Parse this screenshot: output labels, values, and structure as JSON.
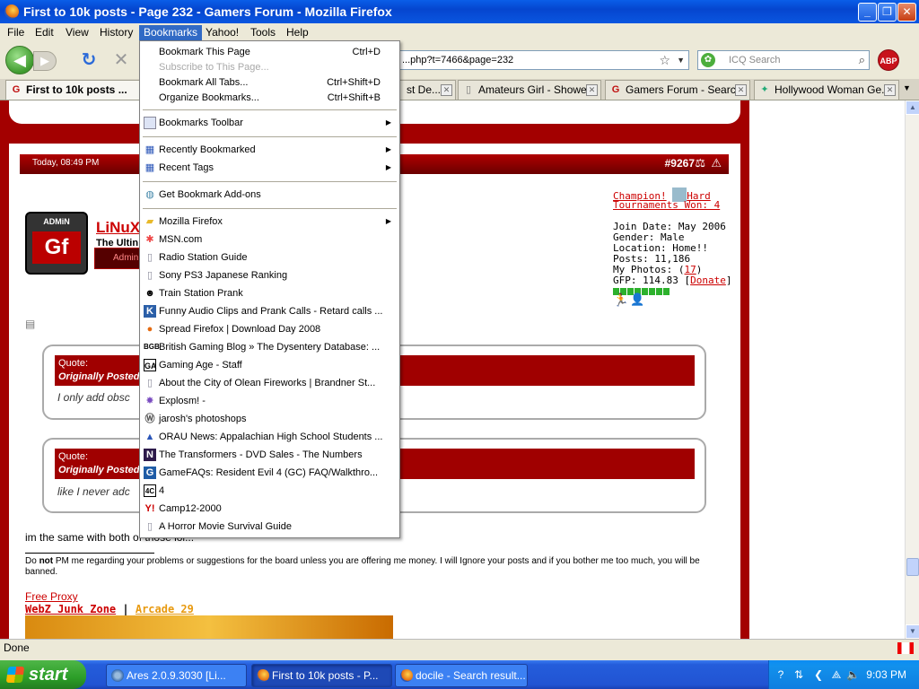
{
  "window": {
    "title": "First to 10k posts - Page 232 - Gamers Forum - Mozilla Firefox"
  },
  "menubar": [
    "File",
    "Edit",
    "View",
    "History",
    "Bookmarks",
    "Yahoo!",
    "Tools",
    "Help"
  ],
  "nav": {
    "url": "...php?t=7466&page=232",
    "search_placeholder": "ICQ Search",
    "abp": "ABP"
  },
  "tabs": [
    {
      "label": "First to 10k posts ...",
      "selected": true
    },
    {
      "label": "st De...",
      "selected": false
    },
    {
      "label": "Amateurs Girl - Showe...",
      "selected": false
    },
    {
      "label": "Gamers Forum - Searc...",
      "selected": false
    },
    {
      "label": "Hollywood Woman Ge...",
      "selected": false
    }
  ],
  "bookmarks_menu": {
    "items": [
      {
        "label": "Bookmark This Page",
        "shortcut": "Ctrl+D"
      },
      {
        "label": "Subscribe to This Page...",
        "shortcut": "",
        "disabled": true
      },
      {
        "label": "Bookmark All Tabs...",
        "shortcut": "Ctrl+Shift+D"
      },
      {
        "label": "Organize Bookmarks...",
        "shortcut": "Ctrl+Shift+B"
      },
      {
        "label": "Bookmarks Toolbar",
        "submenu": true
      },
      {
        "label": "Recently Bookmarked",
        "submenu": true
      },
      {
        "label": "Recent Tags",
        "submenu": true
      },
      {
        "label": "Get Bookmark Add-ons"
      },
      {
        "label": "Mozilla Firefox",
        "submenu": true
      },
      {
        "label": "MSN.com"
      },
      {
        "label": "Radio Station Guide"
      },
      {
        "label": "Sony PS3 Japanese Ranking"
      },
      {
        "label": "Train Station Prank"
      },
      {
        "label": "Funny Audio Clips and Prank Calls - Retard calls ..."
      },
      {
        "label": "Spread Firefox | Download Day 2008"
      },
      {
        "label": "British Gaming Blog » The Dysentery Database: ..."
      },
      {
        "label": "Gaming Age - Staff"
      },
      {
        "label": "About the City of Olean Fireworks | Brandner St..."
      },
      {
        "label": "Explosm! -"
      },
      {
        "label": "jarosh's photoshops"
      },
      {
        "label": "ORAU News: Appalachian High School Students ..."
      },
      {
        "label": "The Transformers - DVD Sales - The Numbers"
      },
      {
        "label": "GameFAQs: Resident Evil 4 (GC) FAQ/Walkthro..."
      },
      {
        "label": "4"
      },
      {
        "label": "Camp12-2000"
      },
      {
        "label": "A Horror Movie Survival Guide"
      }
    ]
  },
  "post": {
    "date": "Today, 08:49 PM",
    "number": "#9267",
    "username": "LiNuX",
    "user_title": "The Ultin",
    "rank_badge": "Admin",
    "avatar_text": "ADMiN",
    "champion_link": "Champion!",
    "hard_link": "Hard",
    "tournaments": "Tournaments Won: 4",
    "join_date": "Join Date: May 2006",
    "gender": "Gender: Male",
    "location": "Location: Home!!",
    "posts": "Posts: 11,186",
    "photos_label": "My Photos: (",
    "photos_count": "17",
    "photos_end": ")",
    "gfp_label": "GFP: 114.83 [",
    "donate": "Donate",
    "gfp_end": "]",
    "quote_label": "Quote:",
    "quote_posted": "Originally Posted",
    "quote1_text": "I only add obsc",
    "quote2_text": "like I never adc",
    "body": "im the same with both of those lol...",
    "sig_pre": "Do ",
    "sig_bold": "not",
    "sig_post": " PM me regarding your problems or suggestions for the board unless you are offering me money. I will Ignore your posts and if you bother me too much, you will be banned.",
    "sig_link1": "Free Proxy",
    "sig_link2": "WebZ Junk Zone",
    "sig_sep": "|",
    "sig_link3": "Arcade 29"
  },
  "status": {
    "text": "Done"
  },
  "taskbar": {
    "start": "start",
    "tasks": [
      {
        "label": "Ares 2.0.9.3030   [Li..."
      },
      {
        "label": "First to 10k posts - P..."
      },
      {
        "label": "docile - Search result..."
      }
    ],
    "clock": "9:03 PM"
  }
}
